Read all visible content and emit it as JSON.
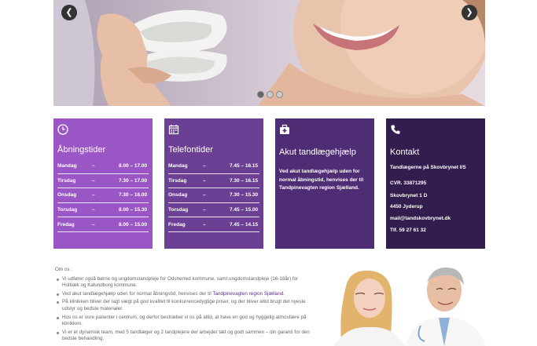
{
  "slider": {
    "prev_label": "❮",
    "next_label": "❯",
    "dots": 3,
    "active_dot": 0
  },
  "boxes": {
    "opening": {
      "title": "Åbningstider",
      "rows": [
        {
          "day": "Mandag",
          "dash": "–",
          "time": "8.00 – 17.00"
        },
        {
          "day": "Tirsdag",
          "dash": "–",
          "time": "7.30 – 17.00"
        },
        {
          "day": "Onsdag",
          "dash": "–",
          "time": "7.30 – 16.00"
        },
        {
          "day": "Torsdag",
          "dash": "–",
          "time": "8.00 – 15.30"
        },
        {
          "day": "Fredag",
          "dash": "–",
          "time": "8.00 – 15.00"
        }
      ]
    },
    "phone": {
      "title": "Telefontider",
      "rows": [
        {
          "day": "Mandag",
          "dash": "–",
          "time": "7.45 – 16.15"
        },
        {
          "day": "Tirsdag",
          "dash": "–",
          "time": "7.30 – 16.15"
        },
        {
          "day": "Onsdag",
          "dash": "–",
          "time": "7.30 – 15.30"
        },
        {
          "day": "Torsdag",
          "dash": "–",
          "time": "7.45 – 15.00"
        },
        {
          "day": "Fredag",
          "dash": "–",
          "time": "7.45 – 14.15"
        }
      ]
    },
    "emergency": {
      "title": "Akut tandlægehjælp",
      "text": "Ved akut tandlægehjælp uden for normal åbningstid, henvises der til Tandpinevagten region Sjælland."
    },
    "contact": {
      "title": "Kontakt",
      "company": "Tandlægerne på Skovbrynet I/S",
      "cvr": "CVR. 33871295",
      "street": "Skovbrynet 1 D",
      "city": "4450 Jyderup",
      "email": "mail@tandskovbrynet.dk",
      "phone": "Tlf. 59 27 61 32"
    }
  },
  "about": {
    "heading": "Om os :",
    "items": [
      {
        "text": "Vi udfører også børne og ungdomstandpleje for Odsherred kommune, samt ungdomstandpleje (16-18år) for Holbæk og Kalundborg kommune."
      },
      {
        "text": "Ved akut tandlægehjælp uden for normal åbningstid, henvises der til ",
        "link": "Tandpinevagten region Sjælland."
      },
      {
        "text": "På klinikken bliver der lagt vægt på god kvalitet til konkurrencedygtige priser, og der bliver altid brugt det nyeste udstyr og bedste materialer."
      },
      {
        "text": "Hos os er vore patienter i centrum, og derfor bestræber vi os på altid, at have en god og hyggelig atmosfære på klinikken."
      },
      {
        "text": "Vi er et dynamisk team, med 5 tandlæger og 2 tandplejere der arbejder tæt og godt sammen – din garanti for den bedste behandling."
      }
    ]
  },
  "colors": {
    "box_1": "#9b56c6",
    "box_2": "#6b3f94",
    "box_3": "#4f2d74",
    "box_4": "#321d4e",
    "link": "#5a2d8c"
  },
  "icons": {
    "opening": "clock-icon",
    "phone": "calendar-icon",
    "emergency": "medical-kit-icon",
    "contact": "phone-icon"
  }
}
